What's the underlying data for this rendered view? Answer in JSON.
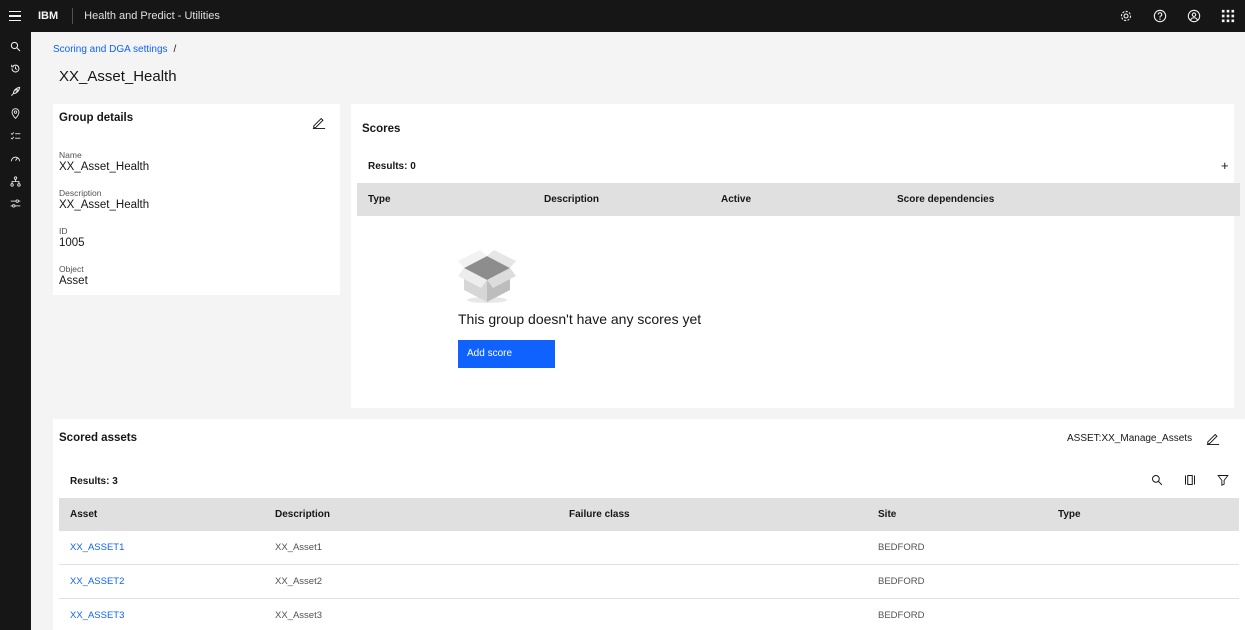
{
  "header": {
    "brand": "IBM",
    "app_title": "Health and Predict - Utilities",
    "icons": [
      "menu-icon",
      "settings-icon",
      "help-icon",
      "user-icon",
      "app-switcher-icon"
    ]
  },
  "sidenav": {
    "icons": [
      "search-icon",
      "recent-icon",
      "rocket-icon",
      "location-icon",
      "checklist-icon",
      "gauge-icon",
      "hierarchy-icon",
      "sliders-icon"
    ]
  },
  "breadcrumb": {
    "link": "Scoring and DGA settings",
    "separator": "/"
  },
  "page_title": "XX_Asset_Health",
  "group_details": {
    "title": "Group details",
    "fields": [
      {
        "label": "Name",
        "value": "XX_Asset_Health"
      },
      {
        "label": "Description",
        "value": "XX_Asset_Health"
      },
      {
        "label": "ID",
        "value": "1005"
      },
      {
        "label": "Object",
        "value": "Asset"
      }
    ]
  },
  "scores": {
    "title": "Scores",
    "results": "Results: 0",
    "add_symbol": "+",
    "columns": [
      "Type",
      "Description",
      "Active",
      "Score dependencies"
    ],
    "empty_message": "This group doesn't have any scores yet",
    "add_button": "Add score"
  },
  "scored_assets": {
    "title": "Scored assets",
    "query": "ASSET:XX_Manage_Assets",
    "results": "Results: 3",
    "columns": [
      "Asset",
      "Description",
      "Failure class",
      "Site",
      "Type"
    ],
    "rows": [
      {
        "asset": "XX_ASSET1",
        "description": "XX_Asset1",
        "failure_class": "",
        "site": "BEDFORD",
        "type": ""
      },
      {
        "asset": "XX_ASSET2",
        "description": "XX_Asset2",
        "failure_class": "",
        "site": "BEDFORD",
        "type": ""
      },
      {
        "asset": "XX_ASSET3",
        "description": "XX_Asset3",
        "failure_class": "",
        "site": "BEDFORD",
        "type": ""
      }
    ]
  },
  "colors": {
    "accent": "#0f62fe",
    "header_bg": "#161616",
    "page_bg": "#f4f4f4",
    "table_head_bg": "#e0e0e0"
  }
}
